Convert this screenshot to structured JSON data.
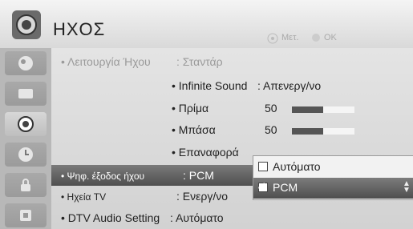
{
  "header": {
    "title": "ΗΧΟΣ",
    "hint_move": "Μετ.",
    "hint_ok": "OK",
    "menu_icon": "speaker-icon"
  },
  "sidebar": {
    "items": [
      {
        "icon": "picture-icon"
      },
      {
        "icon": "tv-icon"
      },
      {
        "icon": "speaker-icon",
        "active": true
      },
      {
        "icon": "clock-icon"
      },
      {
        "icon": "lock-icon"
      },
      {
        "icon": "options-icon"
      }
    ]
  },
  "menu": {
    "sound_mode": {
      "label": "• Λειτουργία Ήχου",
      "value": ": Σταντάρ"
    },
    "infinite_sound": {
      "label": "• Infinite Sound",
      "value": ": Απενεργ/νο"
    },
    "treble": {
      "label": "• Πρίμα",
      "value": "50",
      "level": 0.5
    },
    "bass": {
      "label": "• Μπάσα",
      "value": "50",
      "level": 0.5
    },
    "reset": {
      "label": "• Επαναφορά"
    },
    "digital_out": {
      "label": "• Ψηφ. έξοδος ήχου",
      "value": ": PCM"
    },
    "tv_speaker": {
      "label": "• Ηχεία TV",
      "value": ": Ενεργ/νο"
    },
    "dtv_audio": {
      "label": "• DTV Audio Setting",
      "value": ": Αυτόματο"
    }
  },
  "popup": {
    "options": [
      {
        "label": "Αυτόματο",
        "selected": false
      },
      {
        "label": "PCM",
        "selected": true
      }
    ]
  },
  "colors": {
    "selection": "#5a5a5a",
    "bar_fill": "#555555",
    "bar_track": "#f5f5f5"
  }
}
